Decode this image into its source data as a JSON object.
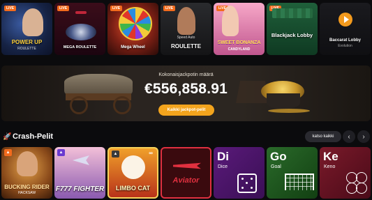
{
  "live_games": {
    "badge": "LIVE",
    "tiles": [
      {
        "title": "POWER UP",
        "subtitle": "ROULETTE"
      },
      {
        "title": "MEGA ROULETTE",
        "subtitle": ""
      },
      {
        "title": "Mega Wheel",
        "subtitle": ""
      },
      {
        "title": "ROULETTE",
        "subtitle": "Speed Auto"
      },
      {
        "title": "SWEET BONANZA",
        "subtitle": "CANDYLAND"
      },
      {
        "title": "Blackjack Lobby",
        "subtitle": ""
      },
      {
        "title": "Baccarat Lobby",
        "subtitle": "Evolution"
      }
    ]
  },
  "jackpot": {
    "title": "Kokonaisjackpotin määrä",
    "amount": "€556,858.91",
    "button": "Kaikki jackpot-pelit"
  },
  "crash": {
    "section_title": "Crash-Pelit",
    "view_all": "katso kaikki",
    "prev_glyph": "‹",
    "next_glyph": "›",
    "games": [
      {
        "title": "BUCKING RIDER",
        "subtitle": "HACKSAW"
      },
      {
        "title": "F777 FIGHTER",
        "subtitle": ""
      },
      {
        "title": "LIMBO CAT",
        "subtitle": ""
      },
      {
        "title": "Aviator",
        "subtitle": ""
      },
      {
        "glyph": "Di",
        "name": "Dice"
      },
      {
        "glyph": "Go",
        "name": "Goal"
      },
      {
        "glyph": "Ke",
        "name": "Keno"
      }
    ]
  }
}
